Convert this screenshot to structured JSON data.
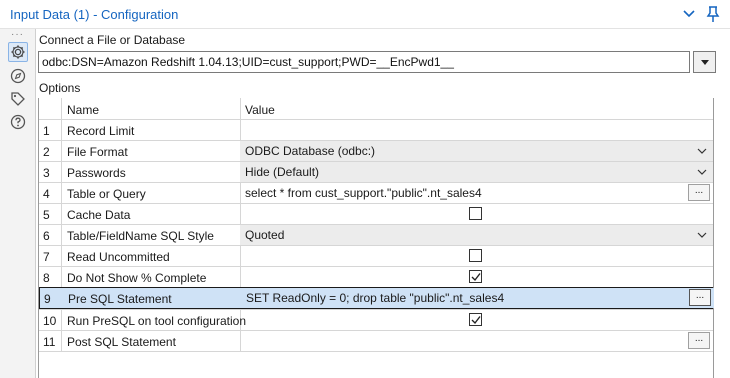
{
  "window": {
    "title": "Input Data (1) - Configuration"
  },
  "sidebar": {
    "icons": [
      "gear-icon",
      "compass-icon",
      "tag-icon",
      "help-icon"
    ]
  },
  "connection": {
    "label": "Connect a File or Database",
    "value": "odbc:DSN=Amazon Redshift 1.04.13;UID=cust_support;PWD=__EncPwd1__"
  },
  "options": {
    "label": "Options",
    "columns": {
      "name": "Name",
      "value": "Value"
    },
    "rows": [
      {
        "num": "1",
        "name": "Record Limit",
        "value": ""
      },
      {
        "num": "2",
        "name": "File Format",
        "value": "ODBC Database (odbc:)"
      },
      {
        "num": "3",
        "name": "Passwords",
        "value": "Hide (Default)"
      },
      {
        "num": "4",
        "name": "Table or Query",
        "value": "select * from cust_support.\"public\".nt_sales4",
        "button": "..."
      },
      {
        "num": "5",
        "name": "Cache Data",
        "checked": false
      },
      {
        "num": "6",
        "name": "Table/FieldName SQL Style",
        "value": "Quoted"
      },
      {
        "num": "7",
        "name": "Read Uncommitted",
        "checked": false
      },
      {
        "num": "8",
        "name": "Do Not Show % Complete",
        "checked": true
      },
      {
        "num": "9",
        "name": "Pre SQL Statement",
        "value": "SET ReadOnly = 0; drop table \"public\".nt_sales4",
        "button": "..."
      },
      {
        "num": "10",
        "name": "Run PreSQL on tool configuration",
        "checked": true
      },
      {
        "num": "11",
        "name": "Post SQL Statement",
        "value": "",
        "button": "..."
      }
    ]
  },
  "colors": {
    "title": "#1565c0",
    "selected_row": "#cfe2f6",
    "dropdown_cell": "#ececec"
  }
}
